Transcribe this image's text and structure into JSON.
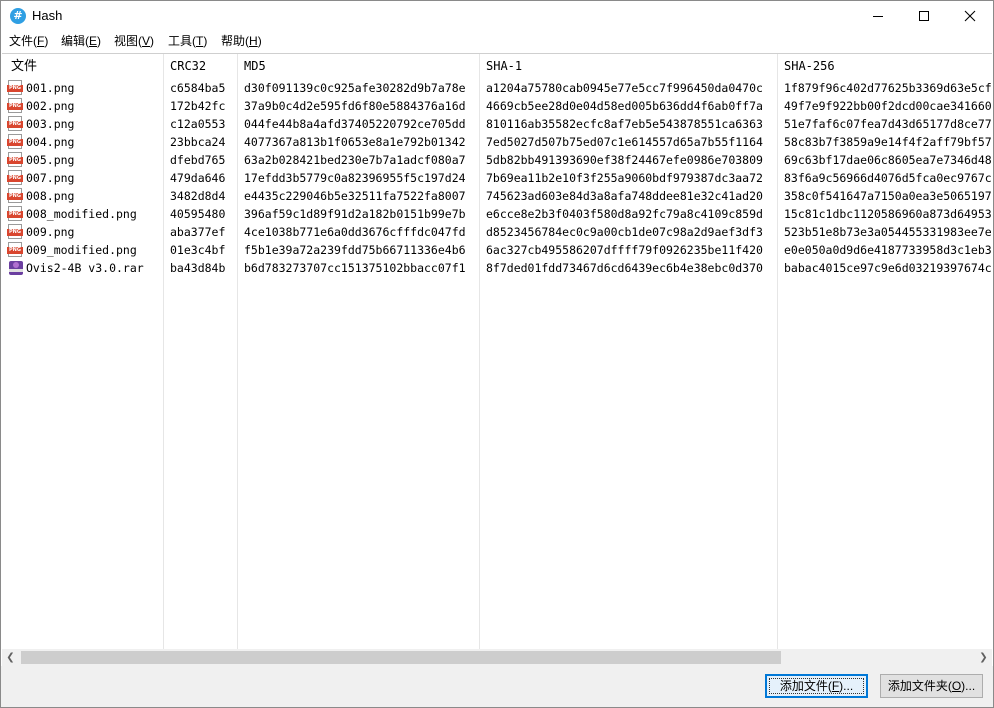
{
  "window": {
    "title": "Hash",
    "app_icon_glyph": "#",
    "accent": "#0078d7"
  },
  "menu": [
    {
      "label": "文件",
      "key": "F"
    },
    {
      "label": "编辑",
      "key": "E"
    },
    {
      "label": "视图",
      "key": "V"
    },
    {
      "label": "工具",
      "key": "T"
    },
    {
      "label": "帮助",
      "key": "H"
    }
  ],
  "columns": [
    "文件",
    "CRC32",
    "MD5",
    "SHA-1",
    "SHA-256"
  ],
  "rows": [
    {
      "file": "001.png",
      "type": "png",
      "crc32": "c6584ba5",
      "md5": "d30f091139c0c925afe30282d9b7a78e",
      "sha1": "a1204a75780cab0945e77e5cc7f996450da0470c",
      "sha256": "1f879f96c402d77625b3369d63e5cf"
    },
    {
      "file": "002.png",
      "type": "png",
      "crc32": "172b42fc",
      "md5": "37a9b0c4d2e595fd6f80e5884376a16d",
      "sha1": "4669cb5ee28d0e04d58ed005b636dd4f6ab0ff7a",
      "sha256": "49f7e9f922bb00f2dcd00cae341660"
    },
    {
      "file": "003.png",
      "type": "png",
      "crc32": "c12a0553",
      "md5": "044fe44b8a4afd37405220792ce705dd",
      "sha1": "810116ab35582ecfc8af7eb5e543878551ca6363",
      "sha256": "51e7faf6c07fea7d43d65177d8ce77"
    },
    {
      "file": "004.png",
      "type": "png",
      "crc32": "23bbca24",
      "md5": "4077367a813b1f0653e8a1e792b01342",
      "sha1": "7ed5027d507b75ed07c1e614557d65a7b55f1164",
      "sha256": "58c83b7f3859a9e14f4f2aff79bf57"
    },
    {
      "file": "005.png",
      "type": "png",
      "crc32": "dfebd765",
      "md5": "63a2b028421bed230e7b7a1adcf080a7",
      "sha1": "5db82bb491393690ef38f24467efe0986e703809",
      "sha256": "69c63bf17dae06c8605ea7e7346d48"
    },
    {
      "file": "007.png",
      "type": "png",
      "crc32": "479da646",
      "md5": "17efdd3b5779c0a82396955f5c197d24",
      "sha1": "7b69ea11b2e10f3f255a9060bdf979387dc3aa72",
      "sha256": "83f6a9c56966d4076d5fca0ec9767c"
    },
    {
      "file": "008.png",
      "type": "png",
      "crc32": "3482d8d4",
      "md5": "e4435c229046b5e32511fa7522fa8007",
      "sha1": "745623ad603e84d3a8afa748ddee81e32c41ad20",
      "sha256": "358c0f541647a7150a0ea3e5065197"
    },
    {
      "file": "008_modified.png",
      "type": "png",
      "crc32": "40595480",
      "md5": "396af59c1d89f91d2a182b0151b99e7b",
      "sha1": "e6cce8e2b3f0403f580d8a92fc79a8c4109c859d",
      "sha256": "15c81c1dbc1120586960a873d64953"
    },
    {
      "file": "009.png",
      "type": "png",
      "crc32": "aba377ef",
      "md5": "4ce1038b771e6a0dd3676cfffdc047fd",
      "sha1": "d8523456784ec0c9a00cb1de07c98a2d9aef3df3",
      "sha256": "523b51e8b73e3a054455331983ee7e"
    },
    {
      "file": "009_modified.png",
      "type": "png",
      "crc32": "01e3c4bf",
      "md5": "f5b1e39a72a239fdd75b66711336e4b6",
      "sha1": "6ac327cb495586207dffff79f0926235be11f420",
      "sha256": "e0e050a0d9d6e4187733958d3c1eb3"
    },
    {
      "file": "Ovis2-4B v3.0.rar",
      "type": "rar",
      "crc32": "ba43d84b",
      "md5": "b6d783273707cc151375102bbacc07f1",
      "sha1": "8f7ded01fdd73467d6cd6439ec6b4e38ebc0d370",
      "sha256": "babac4015ce97c9e6d03219397674c"
    }
  ],
  "buttons": {
    "add_file": {
      "label": "添加文件",
      "key": "F",
      "suffix": "..."
    },
    "add_folder": {
      "label": "添加文件夹",
      "key": "O",
      "suffix": "..."
    }
  }
}
